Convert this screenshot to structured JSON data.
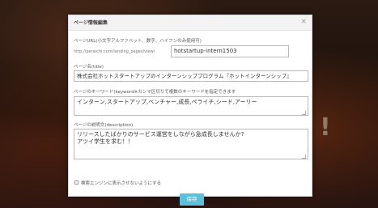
{
  "background": {
    "accent": "#5bc0de"
  },
  "modal": {
    "title": "ページ情報編集",
    "close_symbol": "×",
    "url_section": {
      "label": "ページURL(小文字アルファベット、数字、ハイフンのみ使用可)",
      "prefix": "http://peraichi.com/landing_pages/view/",
      "value": "hotstartup-intern1503"
    },
    "title_section": {
      "label": "ページ名(title)",
      "value": "株式会社ホットスタートアップのインターンシッププログラム『ホットインターンシップ』"
    },
    "keyword_section": {
      "label": "ページのキーワード(keyword※カンマ区切りで複数のキーワードを指定できます",
      "value": "インターン,スタートアップ,ベンチャー,成長,ペライチ,シード,アーリー"
    },
    "description_section": {
      "label": "ページの説明文(description)",
      "value": "リリースしたばかりのサービス運営をしながら急成長しませんか?\nアツイ学生を求む！！"
    },
    "hide_from_search": {
      "label": "検索エンジンに表示させないようにする",
      "checked": false
    },
    "save_label": "保存"
  }
}
